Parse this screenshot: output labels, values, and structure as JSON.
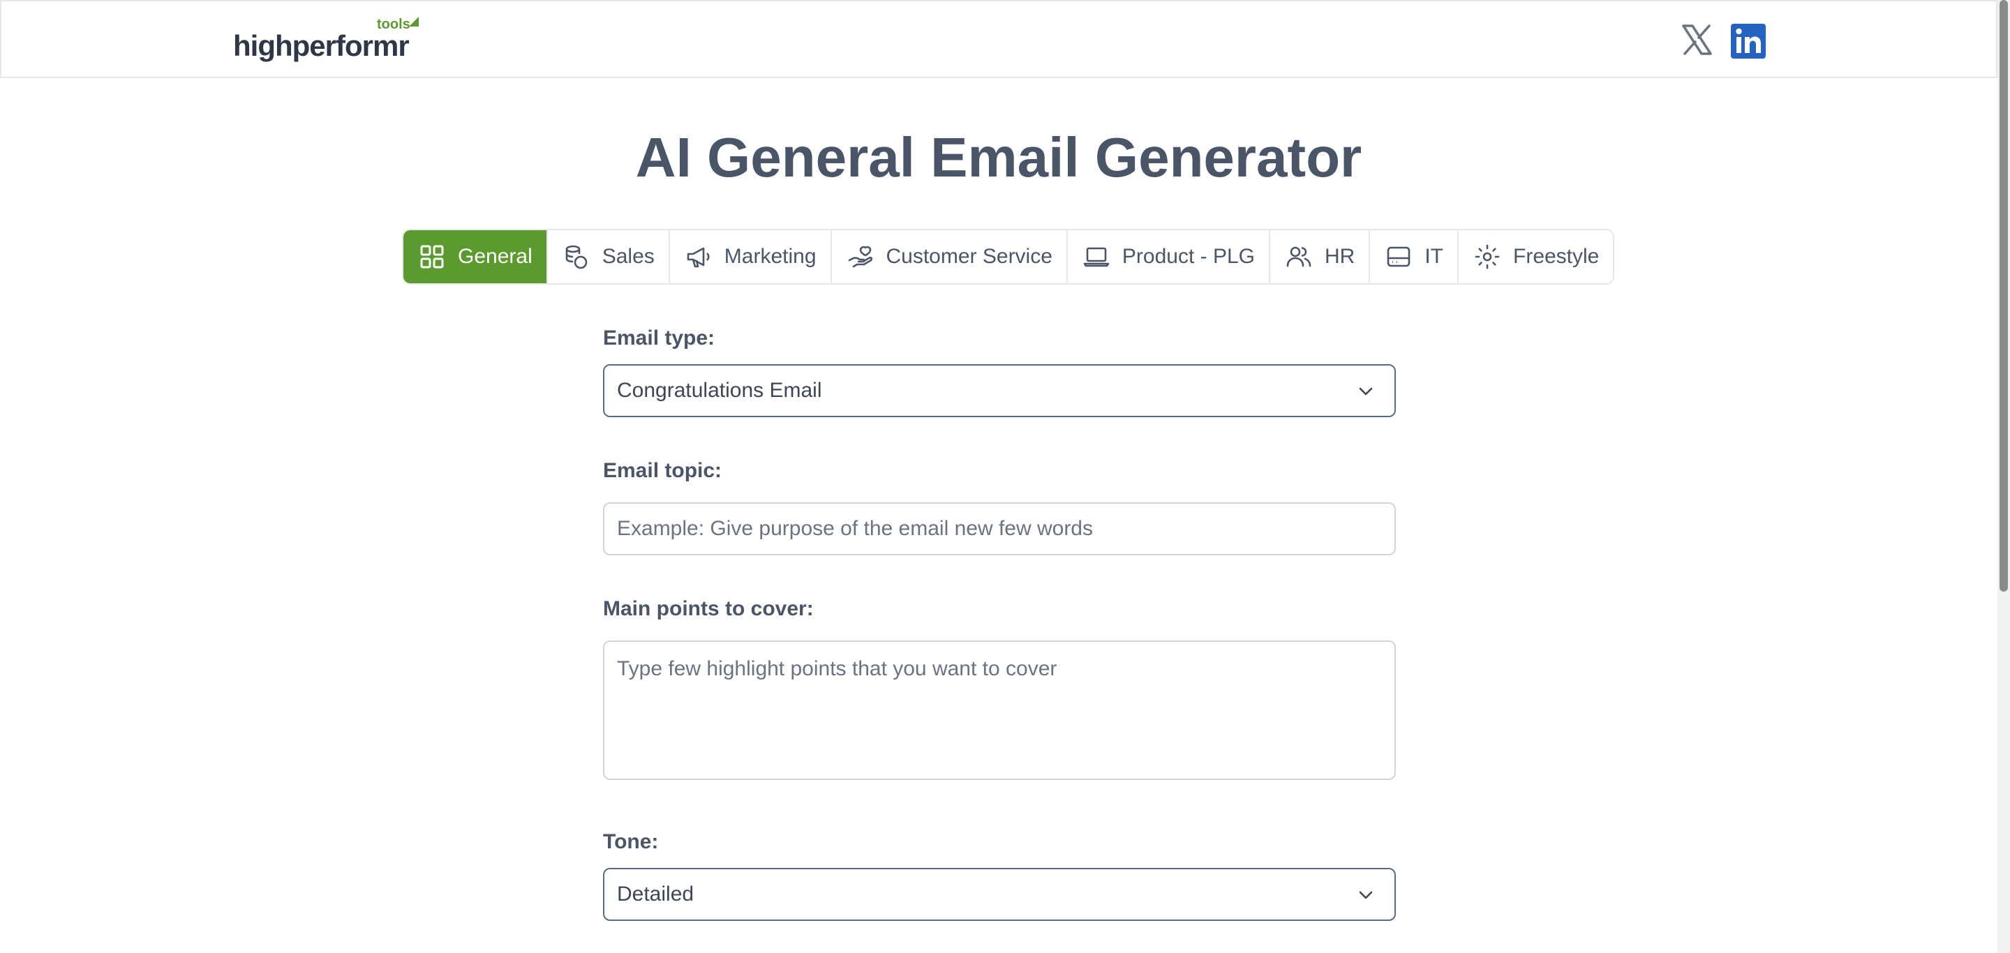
{
  "header": {
    "logo_text": "highperformr",
    "logo_badge": "tools",
    "social": [
      {
        "name": "x",
        "icon": "x-icon"
      },
      {
        "name": "linkedin",
        "icon": "linkedin-icon"
      }
    ]
  },
  "page": {
    "title": "AI General Email Generator"
  },
  "tabs": [
    {
      "label": "General",
      "icon": "grid-icon",
      "active": true
    },
    {
      "label": "Sales",
      "icon": "coins-icon",
      "active": false
    },
    {
      "label": "Marketing",
      "icon": "megaphone-icon",
      "active": false
    },
    {
      "label": "Customer Service",
      "icon": "hand-heart-icon",
      "active": false
    },
    {
      "label": "Product - PLG",
      "icon": "laptop-icon",
      "active": false
    },
    {
      "label": "HR",
      "icon": "users-icon",
      "active": false
    },
    {
      "label": "IT",
      "icon": "hard-drive-icon",
      "active": false
    },
    {
      "label": "Freestyle",
      "icon": "sun-icon",
      "active": false
    }
  ],
  "form": {
    "email_type": {
      "label": "Email type:",
      "value": "Congratulations Email"
    },
    "email_topic": {
      "label": "Email topic:",
      "placeholder": "Example: Give purpose of the email new few words",
      "value": ""
    },
    "main_points": {
      "label": "Main points to cover:",
      "placeholder": "Type few highlight points that you want to cover",
      "value": ""
    },
    "tone": {
      "label": "Tone:",
      "value": "Detailed"
    }
  },
  "colors": {
    "accent": "#5a9a2e",
    "text": "#4a5568",
    "linkedin": "#2563c0"
  }
}
